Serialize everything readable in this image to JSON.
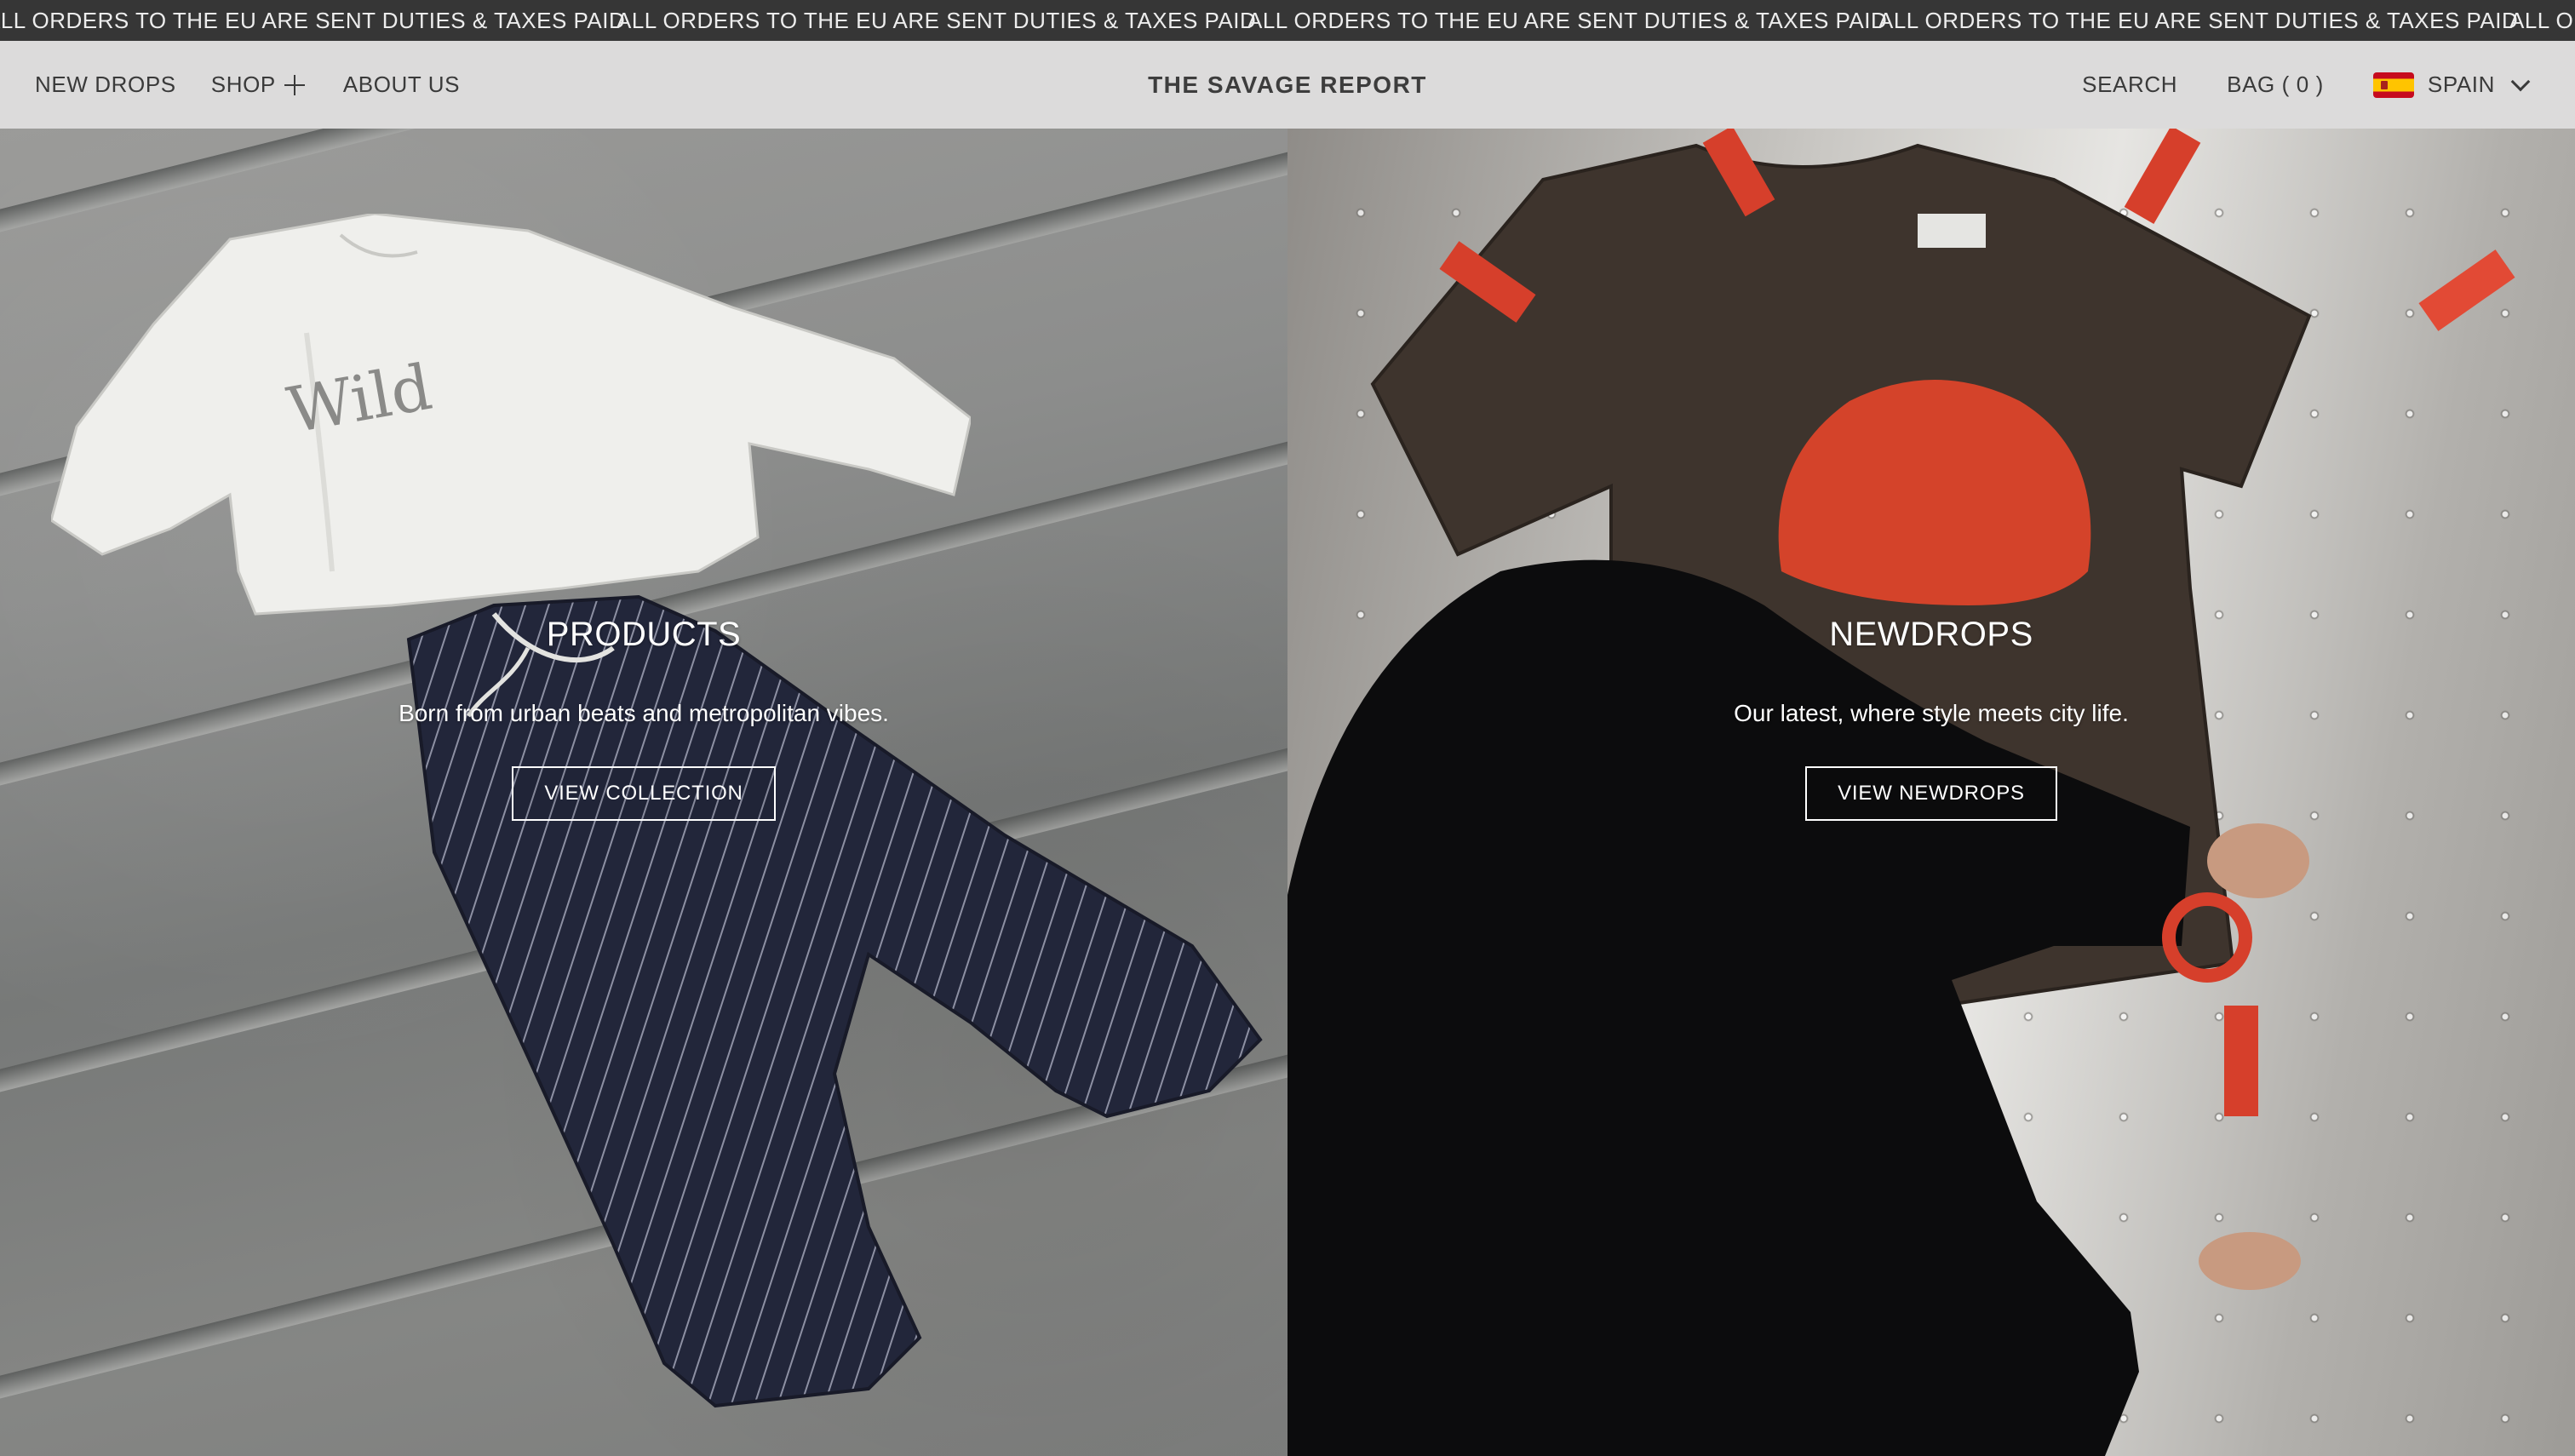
{
  "announcement": {
    "messages": [
      "ALL ORDERS TO THE EU ARE SENT DUTIES & TAXES PAID",
      "ALL ORDERS TO THE EU ARE SENT DUTIES & TAXES PAID",
      "ALL ORDERS TO THE EU ARE SENT DUTIES & TAXES PAID",
      "ALL ORDERS TO THE EU ARE SENT DUTIES & TAXES PAID",
      "ALL OR"
    ]
  },
  "header": {
    "nav": {
      "new_drops": "NEW DROPS",
      "shop": "SHOP",
      "about": "ABOUT US"
    },
    "brand": "THE SAVAGE REPORT",
    "search": "SEARCH",
    "bag": "BAG ( 0 )",
    "country": "SPAIN",
    "icons": {
      "shop_expand": "plus-icon",
      "flag": "spain-flag-icon",
      "country_dropdown": "chevron-down-icon"
    },
    "colors": {
      "background": "#dcdbdb",
      "text": "#3a3a3a"
    }
  },
  "hero": {
    "left": {
      "title": "PRODUCTS",
      "description": "Born from urban beats and metropolitan vibes.",
      "button": "VIEW COLLECTION",
      "image": "white-sweater-and-pinstripe-pants-on-stairs",
      "print_text": "Wild"
    },
    "right": {
      "title": "NEWDROPS",
      "description": "Our latest, where style meets city life.",
      "button": "VIEW NEWDROPS",
      "image": "person-in-red-beanie-taping-brown-tshirt-to-wall"
    }
  },
  "colors": {
    "announcement_bg": "#363636",
    "announcement_text": "#ededed",
    "overlay_text": "#ffffff"
  }
}
